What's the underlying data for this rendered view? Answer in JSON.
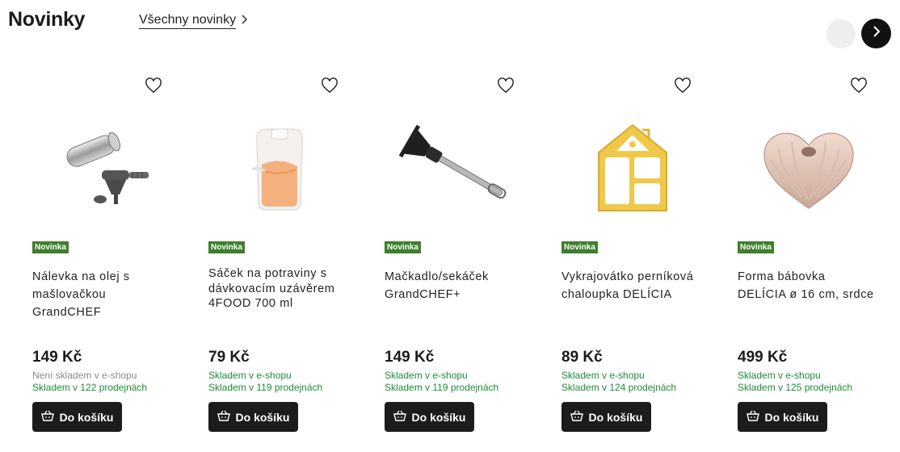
{
  "header": {
    "title": "Novinky",
    "all_link": "Všechny novinky",
    "all_link_icon": "chevron-right-icon"
  },
  "carousel": {
    "prev_button_icon": "chevron-left-icon",
    "next_button_icon": "chevron-right-icon"
  },
  "colors": {
    "badge": "#3f7f2e",
    "in_stock": "#1f8a3a",
    "out_of_stock": "#8a8a8a",
    "button": "#1c1c1c"
  },
  "products": [
    {
      "badge": "Novinka",
      "name": "Nálevka na olej s mašlovačkou GrandCHEF",
      "price": "149 Kč",
      "stock_eshop": "Není skladem v e-shopu",
      "stock_eshop_available": false,
      "stock_stores": "Skladem v 122 prodejnách",
      "button": "Do košíku",
      "image_icon": "oil-funnel-image"
    },
    {
      "badge": "Novinka",
      "name": "Sáček na potraviny s dávkovacím uzávěrem 4FOOD 700 ml",
      "price": "79 Kč",
      "stock_eshop": "Skladem v e-shopu",
      "stock_eshop_available": true,
      "stock_stores": "Skladem v 119 prodejnách",
      "button": "Do košíku",
      "image_icon": "food-pouch-image"
    },
    {
      "badge": "Novinka",
      "name": "Mačkadlo/sekáček GrandCHEF+",
      "price": "149 Kč",
      "stock_eshop": "Skladem v e-shopu",
      "stock_eshop_available": true,
      "stock_stores": "Skladem v 119 prodejnách",
      "button": "Do košíku",
      "image_icon": "masher-image"
    },
    {
      "badge": "Novinka",
      "name": "Vykrajovátko perníková chaloupka DELÍCIA",
      "price": "89 Kč",
      "stock_eshop": "Skladem v e-shopu",
      "stock_eshop_available": true,
      "stock_stores": "Skladem v 124 prodejnách",
      "button": "Do košíku",
      "image_icon": "cookie-cutter-house-image"
    },
    {
      "badge": "Novinka",
      "name": "Forma bábovka DELÍCIA ø 16 cm, srdce",
      "price": "499 Kč",
      "stock_eshop": "Skladem v e-shopu",
      "stock_eshop_available": true,
      "stock_stores": "Skladem v 125 prodejnách",
      "button": "Do košíku",
      "image_icon": "heart-bundt-pan-image"
    }
  ]
}
